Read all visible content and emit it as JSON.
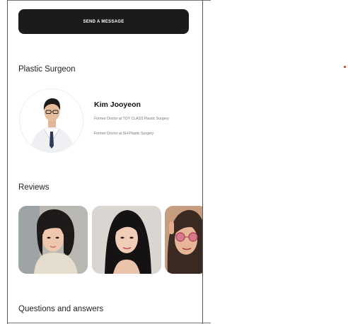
{
  "actions": {
    "send_message_label": "SEND A MESSAGE"
  },
  "surgeon": {
    "section_title": "Plastic Surgeon",
    "name": "Kim Jooyeon",
    "career": [
      "Former Doctor at TOY CLASS Plastic Surgery",
      "Former Doctor at SH Plastic Surgery"
    ]
  },
  "reviews": {
    "section_title": "Reviews",
    "items": [
      {
        "icon": "review-photo-1"
      },
      {
        "icon": "review-photo-2"
      },
      {
        "icon": "review-photo-3"
      }
    ]
  },
  "qa": {
    "section_title": "Questions and answers"
  },
  "colors": {
    "button_bg": "#1b1b1b",
    "button_text": "#ffffff",
    "accent_dot": "#d42a2a"
  }
}
